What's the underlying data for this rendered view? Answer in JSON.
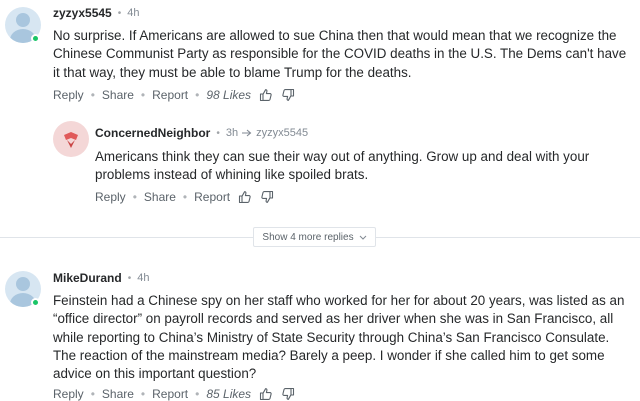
{
  "comments": [
    {
      "username": "zyzyx5545",
      "time": "4h",
      "text": "No surprise. If Americans are allowed to sue China then that would mean that we recognize the Chinese Communist Party as responsible for the COVID deaths in the U.S. The Dems can't have it that way, they must be able to blame Trump for the deaths.",
      "reply_label": "Reply",
      "share_label": "Share",
      "report_label": "Report",
      "likes": "98 Likes",
      "avatar_icon": "user-silhouette-icon",
      "online": true
    },
    {
      "username": "ConcernedNeighbor",
      "time": "3h",
      "reply_to": "zyzyx5545",
      "text": "Americans think they can sue their way out of anything. Grow up and deal with your problems instead of whining like spoiled brats.",
      "reply_label": "Reply",
      "share_label": "Share",
      "report_label": "Report",
      "avatar_icon": "bird-avatar-icon"
    },
    {
      "username": "MikeDurand",
      "time": "4h",
      "text": "Feinstein had a Chinese spy on her staff who worked for her for about 20 years, was listed as an “office director” on payroll records and served as her driver when she was in San Francisco, all while reporting to China’s Ministry of State Security through China’s San Francisco Consulate. The reaction of the mainstream media? Barely a peep.  I wonder if she called him to get some advice on this important question?",
      "reply_label": "Reply",
      "share_label": "Share",
      "report_label": "Report",
      "likes": "85 Likes",
      "avatar_icon": "user-silhouette-icon",
      "online": true
    }
  ],
  "show_more_label": "Show 4 more replies",
  "colors": {
    "online": "#1ac567",
    "text": "#26282a",
    "muted": "#828a93",
    "divider": "#e0e4e9"
  }
}
